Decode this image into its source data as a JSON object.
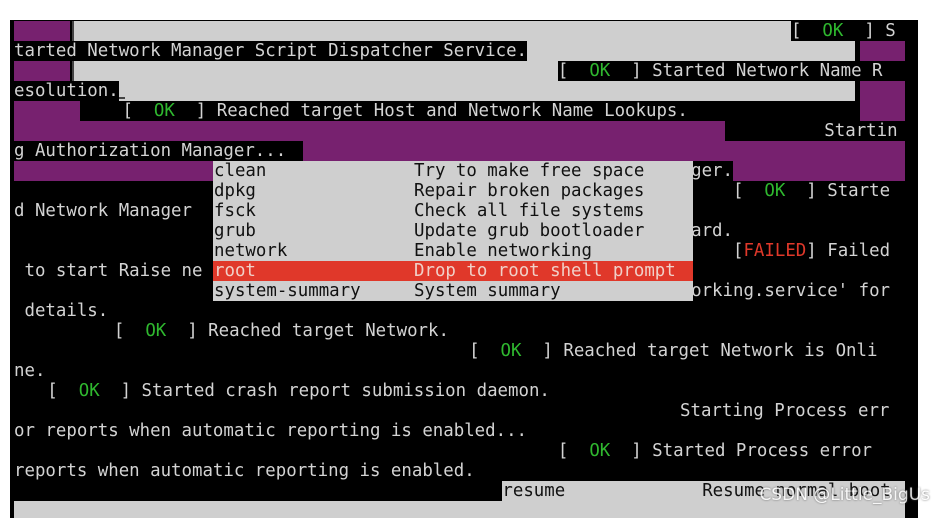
{
  "colors": {
    "purple": "#77216f",
    "gray": "#cfcfcf",
    "ok": "#2fb82f",
    "failed": "#e0382a",
    "highlight": "#e0382a"
  },
  "console": {
    "l0": {
      "pre": "[  ",
      "status": "OK",
      "post": "  ] S"
    },
    "l1": "tarted Network Manager Script Dispatcher Service.",
    "l2": {
      "pre": "[  ",
      "status": "OK",
      "post": "  ] Started Network Name R"
    },
    "l3": "esolution.",
    "l4": {
      "pre": "    [  ",
      "status": "OK",
      "post": "  ] Reached target Host and Network Name Lookups."
    },
    "l5": "Startin",
    "l6": "g Authorization Manager...",
    "l7": "ger.",
    "l8": {
      "pre": "    [  ",
      "status": "OK",
      "post": "  ] Starte"
    },
    "l9": "d Network Manager ",
    "l10": "ard.",
    "l11": {
      "pre": "    [",
      "status": "FAILED",
      "post": "] Failed"
    },
    "l12": " to start Raise ne",
    "l13": "orking.service' for",
    "l14": " details.",
    "l15": {
      "pre": "[  ",
      "status": "OK",
      "post": "  ] Reached target Network."
    },
    "l16": {
      "pre": "[  ",
      "status": "OK",
      "post": "  ] Reached target Network is Onli"
    },
    "l17": "ne.",
    "l18": {
      "pre": "[  ",
      "status": "OK",
      "post": "  ] Started crash report submission daemon."
    },
    "l19": "Starting Process err",
    "l20": "or reports when automatic reporting is enabled...",
    "l21": {
      "pre": "[  ",
      "status": "OK",
      "post": "  ] Started Process error"
    },
    "l22": "reports when automatic reporting is enabled."
  },
  "menu": {
    "items": [
      {
        "name": "clean",
        "desc": "Try to make free space"
      },
      {
        "name": "dpkg",
        "desc": "Repair broken packages"
      },
      {
        "name": "fsck",
        "desc": "Check all file systems"
      },
      {
        "name": "grub",
        "desc": "Update grub bootloader"
      },
      {
        "name": "network",
        "desc": "Enable networking"
      },
      {
        "name": "root",
        "desc": "Drop to root shell prompt"
      },
      {
        "name": "system-summary",
        "desc": "System summary"
      }
    ],
    "selected": "root",
    "resume": {
      "name": "resume",
      "desc": "Resume normal boot"
    }
  },
  "watermark": "CSDN @Little_BigUs"
}
